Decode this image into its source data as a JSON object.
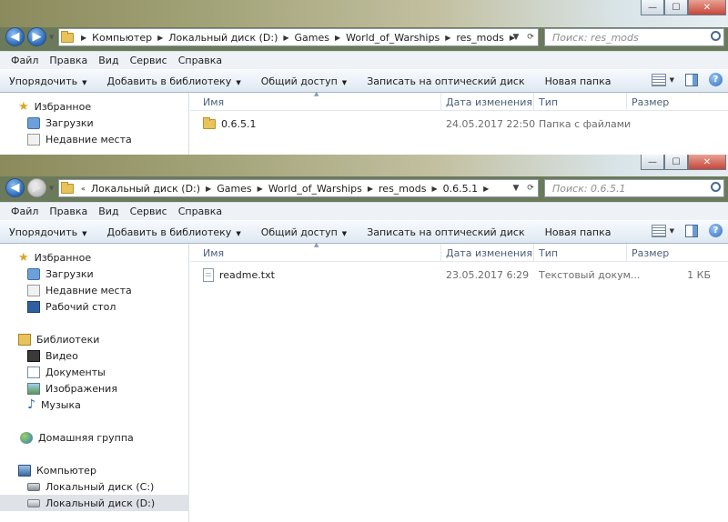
{
  "window1": {
    "title_buttons": {
      "minimize": "—",
      "maximize": "☐",
      "close": "✕"
    },
    "breadcrumbs": [
      "Компьютер",
      "Локальный диск (D:)",
      "Games",
      "World_of_Warships",
      "res_mods"
    ],
    "search_placeholder": "Поиск: res_mods",
    "menu": [
      "Файл",
      "Правка",
      "Вид",
      "Сервис",
      "Справка"
    ],
    "toolbar": {
      "organize": "Упорядочить",
      "add_to_library": "Добавить в библиотеку",
      "share": "Общий доступ",
      "burn": "Записать на оптический диск",
      "new_folder": "Новая папка"
    },
    "nav": {
      "favorites": "Избранное",
      "downloads": "Загрузки",
      "recent": "Недавние места"
    },
    "columns": {
      "name": "Имя",
      "date": "Дата изменения",
      "type": "Тип",
      "size": "Размер"
    },
    "files": [
      {
        "name": "0.6.5.1",
        "date": "24.05.2017 22:50",
        "type": "Папка с файлами",
        "size": ""
      }
    ]
  },
  "window2": {
    "title_buttons": {
      "minimize": "—",
      "maximize": "☐",
      "close": "✕"
    },
    "breadcrumb_overflow": "«",
    "breadcrumbs": [
      "Локальный диск (D:)",
      "Games",
      "World_of_Warships",
      "res_mods",
      "0.6.5.1"
    ],
    "search_placeholder": "Поиск: 0.6.5.1",
    "menu": [
      "Файл",
      "Правка",
      "Вид",
      "Сервис",
      "Справка"
    ],
    "toolbar": {
      "organize": "Упорядочить",
      "add_to_library": "Добавить в библиотеку",
      "share": "Общий доступ",
      "burn": "Записать на оптический диск",
      "new_folder": "Новая папка"
    },
    "nav": {
      "favorites": "Избранное",
      "downloads": "Загрузки",
      "recent": "Недавние места",
      "desktop": "Рабочий стол",
      "libraries": "Библиотеки",
      "video": "Видео",
      "documents": "Документы",
      "images": "Изображения",
      "music": "Музыка",
      "homegroup": "Домашняя группа",
      "computer": "Компьютер",
      "drive_c": "Локальный диск (C:)",
      "drive_d": "Локальный диск (D:)"
    },
    "columns": {
      "name": "Имя",
      "date": "Дата изменения",
      "type": "Тип",
      "size": "Размер"
    },
    "files": [
      {
        "name": "readme.txt",
        "date": "23.05.2017 6:29",
        "type": "Текстовый докум...",
        "size": "1 КБ"
      }
    ]
  },
  "colors": {
    "accent": "#2a66b8",
    "selection": "#dfe2e6",
    "header_text": "#4c607a"
  }
}
